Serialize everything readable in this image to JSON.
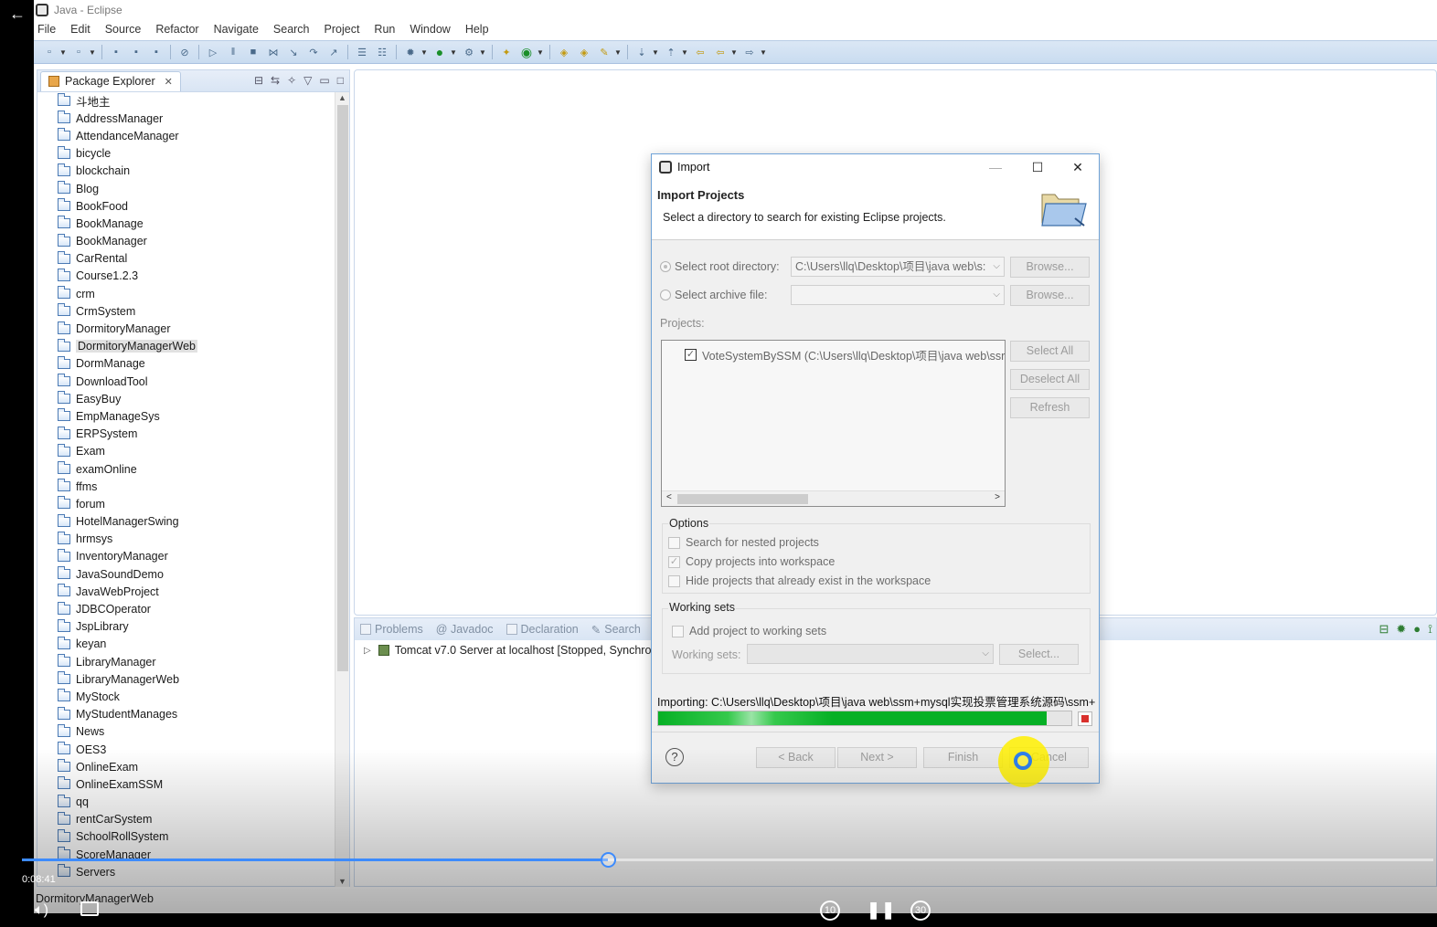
{
  "window": {
    "title": "Java - Eclipse"
  },
  "menu": [
    "File",
    "Edit",
    "Source",
    "Refactor",
    "Navigate",
    "Search",
    "Project",
    "Run",
    "Window",
    "Help"
  ],
  "package_explorer": {
    "tab_label": "Package Explorer",
    "projects": [
      "斗地主",
      "AddressManager",
      "AttendanceManager",
      "bicycle",
      "blockchain",
      "Blog",
      "BookFood",
      "BookManage",
      "BookManager",
      "CarRental",
      "Course1.2.3",
      "crm",
      "CrmSystem",
      "DormitoryManager",
      "DormitoryManagerWeb",
      "DormManage",
      "DownloadTool",
      "EasyBuy",
      "EmpManageSys",
      "ERPSystem",
      "Exam",
      "examOnline",
      "ffms",
      "forum",
      "HotelManagerSwing",
      "hrmsys",
      "InventoryManager",
      "JavaSoundDemo",
      "JavaWebProject",
      "JDBCOperator",
      "JspLibrary",
      "keyan",
      "LibraryManager",
      "LibraryManagerWeb",
      "MyStock",
      "MyStudentManages",
      "News",
      "OES3",
      "OnlineExam",
      "OnlineExamSSM",
      "qq",
      "rentCarSystem",
      "SchoolRollSystem",
      "ScoreManager",
      "Servers"
    ],
    "selected": "DormitoryManagerWeb"
  },
  "bottom_view": {
    "tabs": [
      "Problems",
      "@ Javadoc",
      "Declaration",
      "Search"
    ],
    "server_row": "Tomcat v7.0 Server at localhost  [Stopped, Synchro"
  },
  "status_bar": {
    "text": "DormitoryManagerWeb"
  },
  "dialog": {
    "title": "Import",
    "header_title": "Import Projects",
    "header_desc": "Select a directory to search for existing Eclipse projects.",
    "root_dir_label": "Select root directory:",
    "root_dir_value": "C:\\Users\\llq\\Desktop\\项目\\java web\\s:",
    "archive_label": "Select archive file:",
    "archive_value": "",
    "browse_label": "Browse...",
    "projects_label": "Projects:",
    "project_item": "VoteSystemBySSM (C:\\Users\\llq\\Desktop\\项目\\java web\\ssr",
    "select_all": "Select All",
    "deselect_all": "Deselect All",
    "refresh": "Refresh",
    "options_title": "Options",
    "opt_nested": "Search for nested projects",
    "opt_copy": "Copy projects into workspace",
    "opt_hide": "Hide projects that already exist in the workspace",
    "working_sets_title": "Working sets",
    "add_working_sets": "Add project to working sets",
    "working_sets_label": "Working sets:",
    "select_btn": "Select...",
    "importing_text": "Importing: C:\\Users\\llq\\Desktop\\项目\\java web\\ssm+mysql实现投票管理系统源码\\ssm+",
    "progress": 0.94,
    "back": "< Back",
    "next": "Next >",
    "finish": "Finish",
    "cancel": "Cancel",
    "help_glyph": "?"
  },
  "video": {
    "time": "0:08:41",
    "progress": 0.415,
    "rewind_label": "10",
    "forward_label": "30"
  },
  "colors": {
    "progress_green": "#06b025",
    "video_accent": "#3d8bfd",
    "click_highlight": "#fff000"
  }
}
